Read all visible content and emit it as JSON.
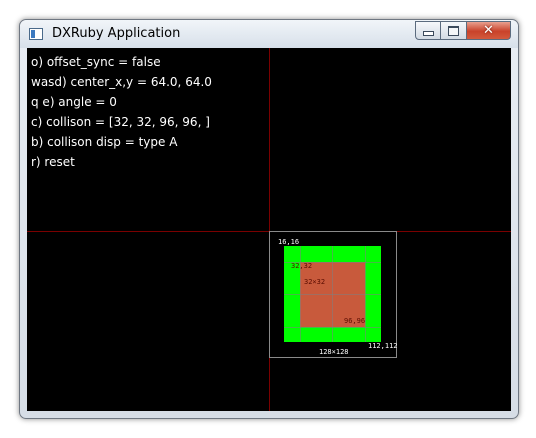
{
  "window": {
    "title": "DXRuby Application",
    "controls": {
      "minimize": "minimize",
      "maximize": "maximize",
      "close": "✕"
    }
  },
  "info_lines": [
    "o) offset_sync = false",
    "wasd) center_x,y = 64.0, 64.0",
    "q e) angle = 0",
    "c) collison = [32, 32, 96, 96, ]",
    "b) collison disp = type A",
    "r) reset"
  ],
  "sprite": {
    "top_left_label": "16,16",
    "collision_start_label": "32,32",
    "collision_size_label": "32×32",
    "collision_end_label": "96,96",
    "bottom_right_label": "112,112",
    "size_label": "128×128",
    "colors": {
      "sprite": "#00ff00",
      "collision": "#c85a3c",
      "axis": "#7a0000"
    }
  }
}
